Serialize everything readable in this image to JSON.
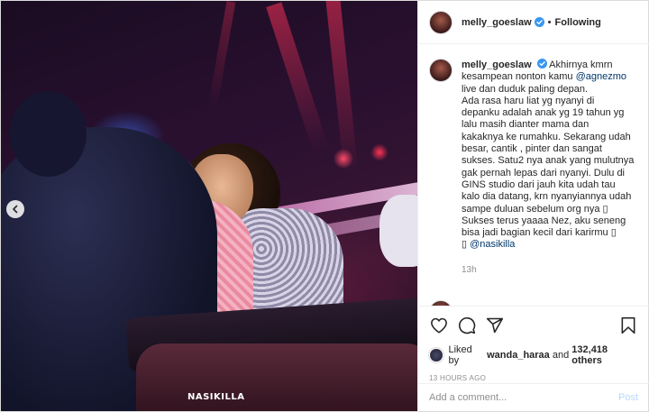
{
  "photo": {
    "watermark": "NASIKILLA",
    "nav_icon": "chevron-left-icon"
  },
  "header": {
    "username": "melly_goeslaw",
    "verified_icon": "verified-badge-icon",
    "separator": "•",
    "follow_status": "Following"
  },
  "caption": {
    "username": "melly_goeslaw",
    "lines": [
      "Akhirnya kmrn",
      "kesampean nonton kamu",
      "live dan duduk paling depan.",
      "Ada rasa haru liat yg nyanyi di",
      "depanku adalah anak yg 19 tahun yg",
      "lalu masih dianter mama dan",
      "kakaknya ke rumahku. Sekarang udah",
      "besar, cantik , pinter dan sangat",
      "sukses. Satu2 nya anak yang mulutnya",
      "gak pernah lepas dari nyanyi. Dulu di",
      "GINS studio dari jauh kita udah tau",
      "kalo dia datang, krn nyanyiannya udah",
      "sampe duluan sebelum org nya",
      "Sukses terus yaaaa Nez, aku seneng",
      "bisa jadi bagian kecil dari karirmu"
    ],
    "mention_1": "@agnezmo",
    "mention_2": "@nasikilla",
    "emoji_placeholder": "▯",
    "age": "13h"
  },
  "actions": {
    "like_icon": "heart-icon",
    "comment_icon": "comment-icon",
    "share_icon": "share-icon",
    "save_icon": "bookmark-icon"
  },
  "likes": {
    "prefix": "Liked by",
    "liker": "wanda_haraa",
    "middle": "and",
    "count": "132,418 others"
  },
  "timestamp": "13 HOURS AGO",
  "add_comment": {
    "placeholder": "Add a comment...",
    "post_label": "Post"
  },
  "colors": {
    "mention": "#00376b",
    "verified": "#3897f0",
    "post_disabled": "#b3dbff",
    "muted": "#8e8e8e"
  }
}
